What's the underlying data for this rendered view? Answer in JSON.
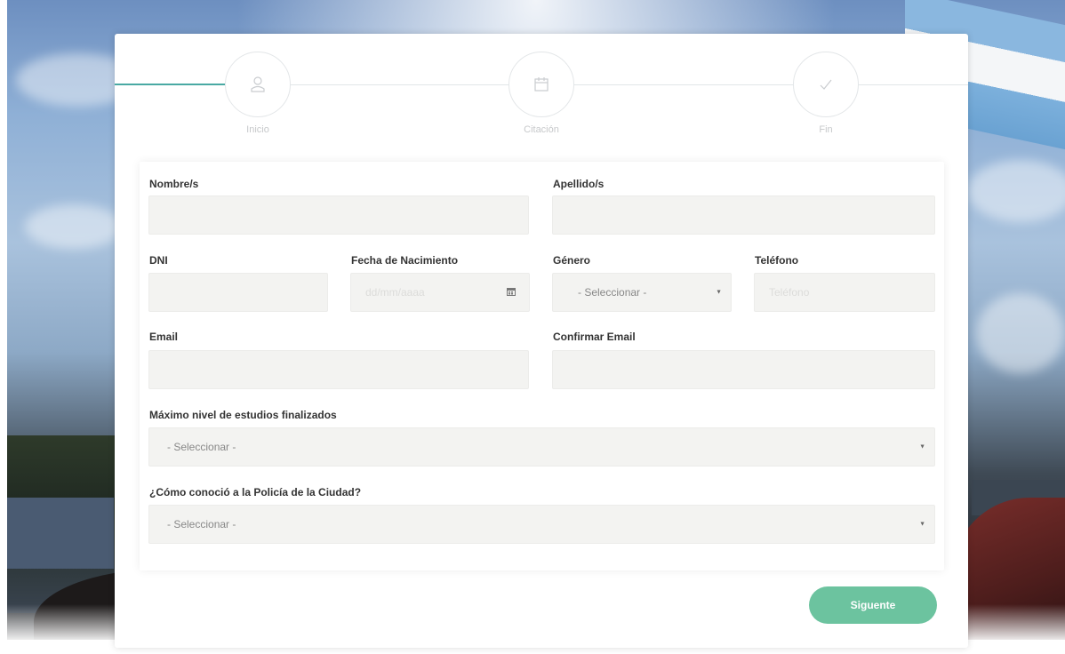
{
  "wizard": {
    "steps": [
      {
        "label": "Inicio",
        "icon": "user-icon"
      },
      {
        "label": "Citación",
        "icon": "calendar-icon"
      },
      {
        "label": "Fin",
        "icon": "check-icon"
      }
    ],
    "accent_color": "#49a9a3"
  },
  "form": {
    "nombre": {
      "label": "Nombre/s",
      "value": ""
    },
    "apellido": {
      "label": "Apellido/s",
      "value": ""
    },
    "dni": {
      "label": "DNI",
      "value": ""
    },
    "fecha": {
      "label": "Fecha de Nacimiento",
      "placeholder": "dd/mm/aaaa"
    },
    "genero": {
      "label": "Género",
      "selected": "- Seleccionar -"
    },
    "telefono": {
      "label": "Teléfono",
      "placeholder": "Teléfono"
    },
    "email": {
      "label": "Email",
      "value": ""
    },
    "confirmar_email": {
      "label": "Confirmar Email",
      "value": ""
    },
    "estudios": {
      "label": "Máximo nivel de estudios finalizados",
      "selected": "- Seleccionar -"
    },
    "como_conocio": {
      "label": "¿Cómo conoció a la Policía de la Ciudad?",
      "selected": "- Seleccionar -"
    }
  },
  "actions": {
    "next_label": "Siguente",
    "next_color": "#6cc39f"
  }
}
